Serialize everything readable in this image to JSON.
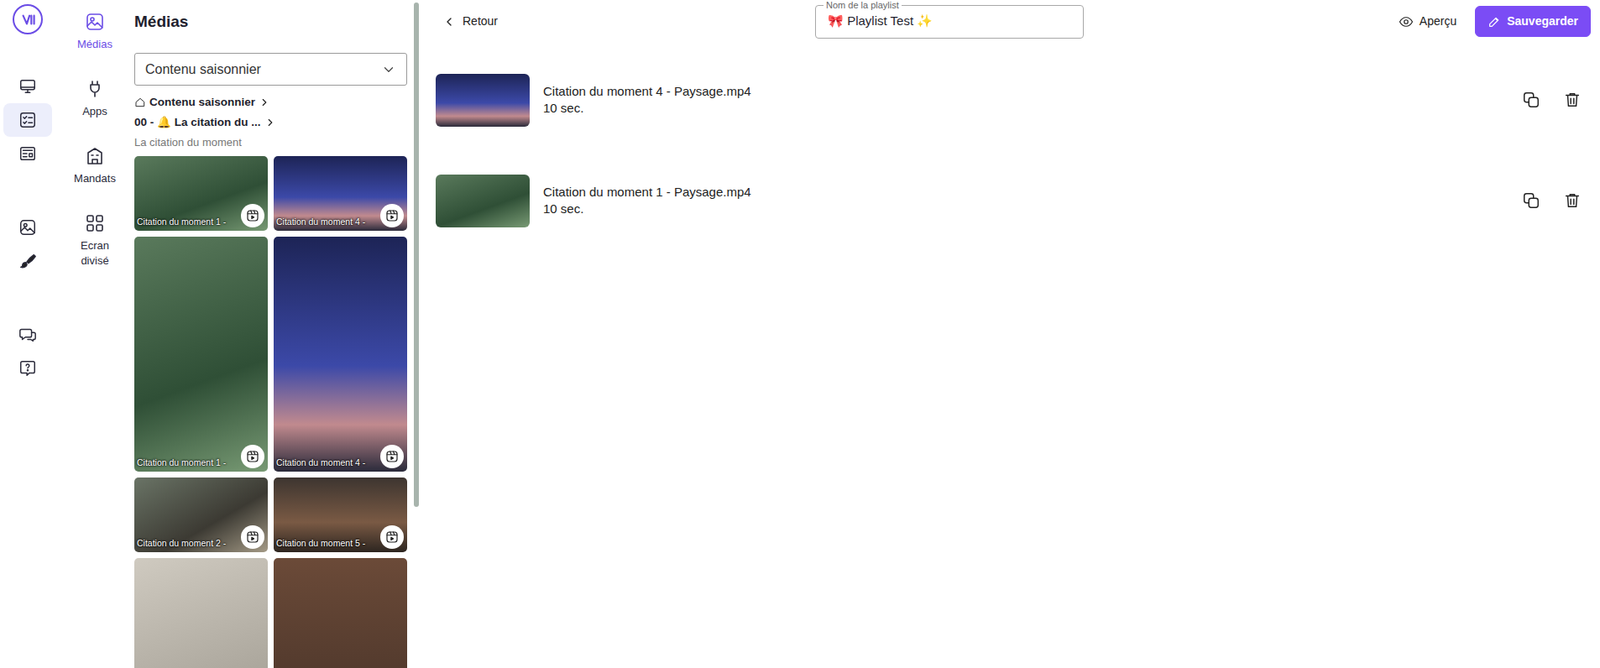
{
  "rail": [
    {
      "selected": false
    },
    {
      "selected": true
    },
    {
      "selected": false
    },
    {
      "selected": false
    },
    {
      "selected": false
    },
    {
      "selected": false
    },
    {
      "selected": false
    }
  ],
  "nav": [
    {
      "label": "Médias",
      "selected": true
    },
    {
      "label": "Apps",
      "selected": false
    },
    {
      "label": "Mandats",
      "selected": false
    },
    {
      "label": "Ecran divisé",
      "selected": false
    }
  ],
  "media": {
    "title": "Médias",
    "folder": "Contenu saisonnier",
    "breadcrumb": [
      "Contenu saisonnier",
      "00 - 🔔 La citation du ..."
    ],
    "subtitle": "La citation du moment",
    "tiles": [
      {
        "label": "Citation du moment 1 -",
        "kind": "landscape"
      },
      {
        "label": "Citation du moment 4 -",
        "kind": "landscape"
      },
      {
        "label": "Citation du moment 1 -",
        "kind": "portrait"
      },
      {
        "label": "Citation du moment 4 -",
        "kind": "portrait"
      },
      {
        "label": "Citation du moment 2 -",
        "kind": "landscape"
      },
      {
        "label": "Citation du moment 5 -",
        "kind": "landscape"
      },
      {
        "kind": "portrait"
      },
      {
        "kind": "portrait"
      }
    ],
    "scrollbar": {
      "level": 0.77
    }
  },
  "header": {
    "back": "Retour",
    "name_label": "Nom de la playlist",
    "name": "🎀 Playlist Test ✨",
    "preview": "Aperçu",
    "save": "Sauvegarder"
  },
  "playlist": [
    {
      "title": "Citation du moment 4 - Paysage.mp4",
      "duration": "10 sec."
    },
    {
      "title": "Citation du moment 1 - Paysage.mp4",
      "duration": "10 sec."
    }
  ]
}
